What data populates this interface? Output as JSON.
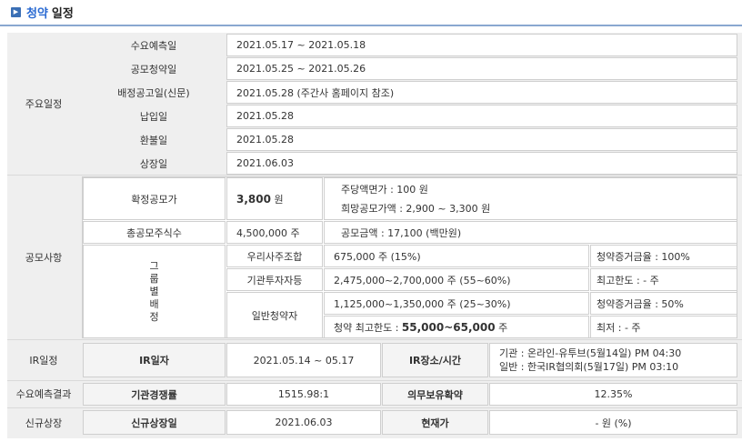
{
  "page_title": {
    "part1": "청약",
    "part2": "일정"
  },
  "main_schedule": {
    "section_label": "주요일정",
    "rows": [
      {
        "label": "수요예측일",
        "value": "2021.05.17  ~  2021.05.18"
      },
      {
        "label": "공모청약일",
        "value": "2021.05.25  ~  2021.05.26"
      },
      {
        "label": "배정공고일(신문)",
        "value": "2021.05.28 (주간사 홈페이지 참조)"
      },
      {
        "label": "납입일",
        "value": "2021.05.28"
      },
      {
        "label": "환불일",
        "value": "2021.05.28"
      },
      {
        "label": "상장일",
        "value": "2021.06.03"
      }
    ]
  },
  "offering": {
    "section_label": "공모사항",
    "final_price_label": "확정공모가",
    "final_price_value": "3,800",
    "final_price_unit": "원",
    "par_value": "주당액면가 :  100 원",
    "desired_price": "희망공모가액 :  2,900 ~ 3,300 원",
    "total_shares_label": "총공모주식수",
    "total_shares_value": "4,500,000 주",
    "amount_text": "공모금액 : 17,100 (백만원)",
    "group_label_chars": [
      "그",
      "룹",
      "별",
      "배",
      "정"
    ],
    "employee": {
      "label": "우리사주조합",
      "value": "675,000 주  (15%)",
      "note": "청약증거금율 : 100%"
    },
    "institution": {
      "label": "기관투자자등",
      "value": "2,475,000~2,700,000 주  (55~60%)",
      "note": "최고한도 :  - 주"
    },
    "retail": {
      "label": "일반청약자",
      "value": "1,125,000~1,350,000 주  (25~30%)",
      "note": "청약증거금율 : 50%",
      "max_limit_prefix": "청약 최고한도 :",
      "max_limit_value": "55,000~65,000",
      "max_limit_unit": "주",
      "min_note": "최저 :  - 주"
    }
  },
  "ir": {
    "section_label": "IR일정",
    "date_label": "IR일자",
    "date_value": "2021.05.14 ~ 05.17",
    "place_label": "IR장소/시간",
    "place_line1": "기관 : 온라인-유투브(5월14일) PM 04:30",
    "place_line2": "일반 : 한국IR협의회(5월17일) PM 03:10"
  },
  "demand_result": {
    "section_label": "수요예측결과",
    "competition_label": "기관경쟁률",
    "competition_value": "1515.98:1",
    "lockup_label": "의무보유확약",
    "lockup_value": "12.35%"
  },
  "new_listing": {
    "section_label": "신규상장",
    "date_label": "신규상장일",
    "date_value": "2021.06.03",
    "price_label": "현재가",
    "price_value": "- 원 (%)"
  }
}
